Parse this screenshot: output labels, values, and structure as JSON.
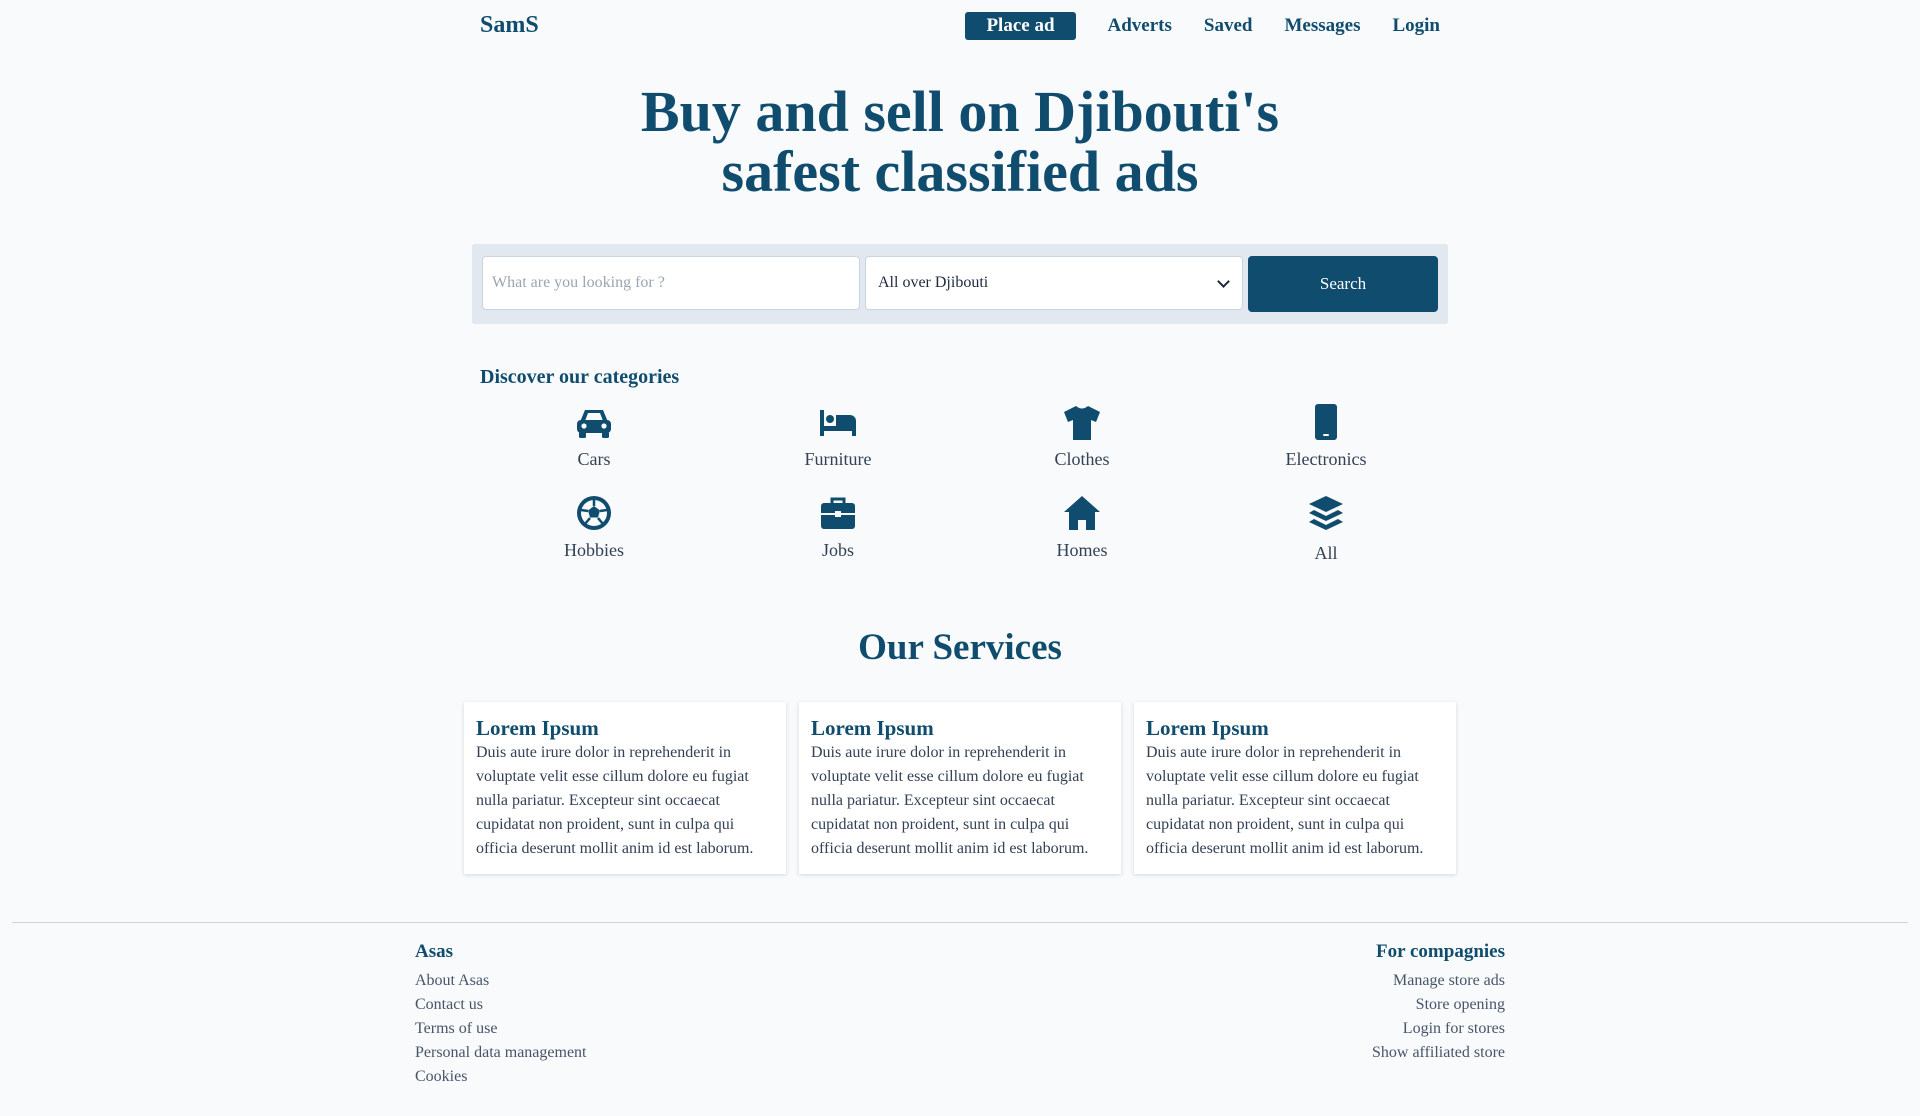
{
  "header": {
    "logo": "SamS",
    "place_ad": "Place ad",
    "links": [
      "Adverts",
      "Saved",
      "Messages",
      "Login"
    ]
  },
  "hero": {
    "line1": "Buy and sell on Djibouti's",
    "line2": "safest classified ads"
  },
  "search": {
    "placeholder": "What are you looking for ?",
    "location_value": "All over Djibouti",
    "button_label": "Search"
  },
  "categories": {
    "title": "Discover our categories",
    "items": [
      {
        "label": "Cars",
        "icon": "car-icon"
      },
      {
        "label": "Furniture",
        "icon": "bed-icon"
      },
      {
        "label": "Clothes",
        "icon": "tshirt-icon"
      },
      {
        "label": "Electronics",
        "icon": "tablet-icon"
      },
      {
        "label": "Hobbies",
        "icon": "soccer-ball-icon"
      },
      {
        "label": "Jobs",
        "icon": "briefcase-icon"
      },
      {
        "label": "Homes",
        "icon": "house-icon"
      },
      {
        "label": "All",
        "icon": "layers-icon"
      }
    ]
  },
  "services": {
    "title": "Our Services",
    "cards": [
      {
        "title": "Lorem Ipsum",
        "body": "Duis aute irure dolor in reprehenderit in voluptate velit esse cillum dolore eu fugiat nulla pariatur. Excepteur sint occaecat cupidatat non proident, sunt in culpa qui officia deserunt mollit anim id est laborum."
      },
      {
        "title": "Lorem Ipsum",
        "body": "Duis aute irure dolor in reprehenderit in voluptate velit esse cillum dolore eu fugiat nulla pariatur. Excepteur sint occaecat cupidatat non proident, sunt in culpa qui officia deserunt mollit anim id est laborum."
      },
      {
        "title": "Lorem Ipsum",
        "body": "Duis aute irure dolor in reprehenderit in voluptate velit esse cillum dolore eu fugiat nulla pariatur. Excepteur sint occaecat cupidatat non proident, sunt in culpa qui officia deserunt mollit anim id est laborum."
      }
    ]
  },
  "footer": {
    "left": {
      "heading": "Asas",
      "links": [
        "About Asas",
        "Contact us",
        "Terms of use",
        "Personal data management",
        "Cookies"
      ]
    },
    "right": {
      "heading": "For compagnies",
      "links": [
        "Manage store ads",
        "Store opening",
        "Login for stores",
        "Show affiliated store"
      ]
    }
  },
  "colors": {
    "primary": "#0f4c6e",
    "background": "#f8fafc",
    "search_bar_bg": "#e2e8f0",
    "text_muted": "#334155"
  }
}
